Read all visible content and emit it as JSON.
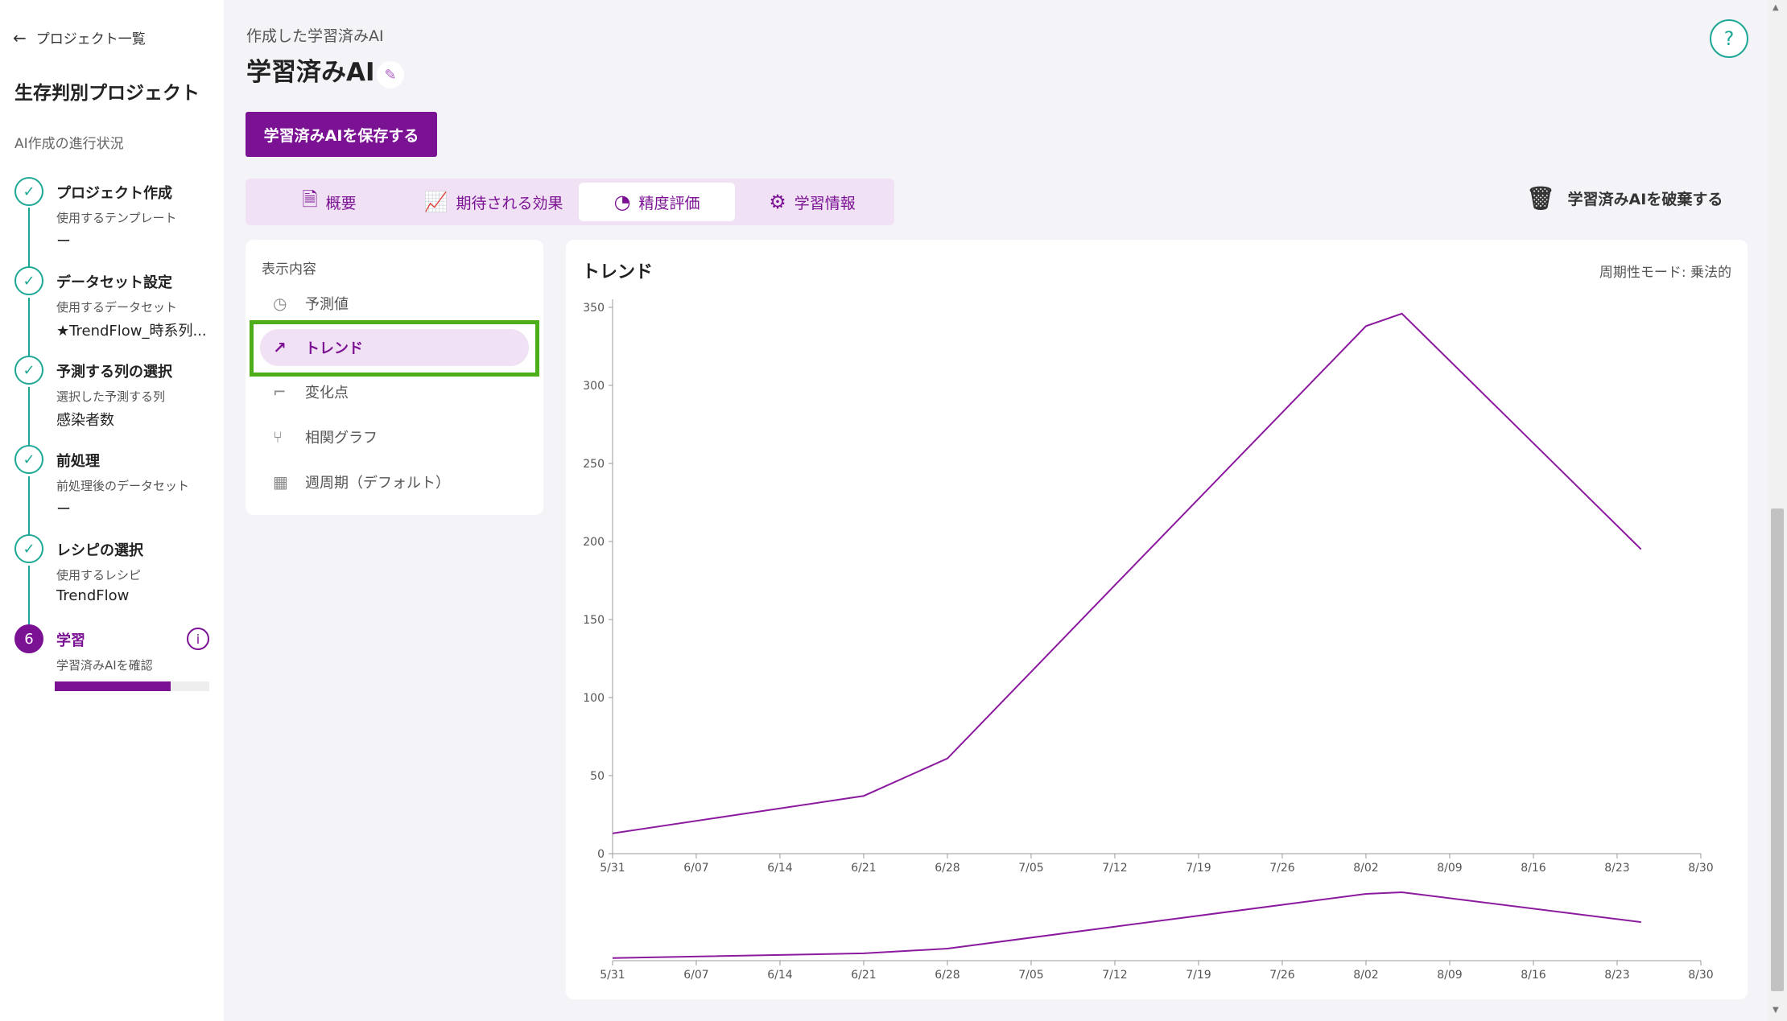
{
  "sidebar": {
    "back_label": "プロジェクト一覧",
    "project_title": "生存判別プロジェクト",
    "progress_heading": "AI作成の進行状況",
    "steps": [
      {
        "name": "プロジェクト作成",
        "sub": "使用するテンプレート",
        "value": "ー",
        "status": "done"
      },
      {
        "name": "データセット設定",
        "sub": "使用するデータセット",
        "value": "★TrendFlow_時系列...",
        "status": "done"
      },
      {
        "name": "予測する列の選択",
        "sub": "選択した予測する列",
        "value": "感染者数",
        "status": "done"
      },
      {
        "name": "前処理",
        "sub": "前処理後のデータセット",
        "value": "ー",
        "status": "done"
      },
      {
        "name": "レシピの選択",
        "sub": "使用するレシピ",
        "value": "TrendFlow",
        "status": "done"
      },
      {
        "name": "学習",
        "sub": "学習済みAIを確認",
        "number": "6",
        "status": "active",
        "progress": 0.75
      }
    ],
    "info_icon": "i"
  },
  "header": {
    "breadcrumb": "作成した学習済みAI",
    "title": "学習済みAI",
    "save_label": "学習済みAIを保存する",
    "help_icon": "?"
  },
  "tabs": [
    {
      "label": "概要",
      "icon": "document-icon"
    },
    {
      "label": "期待される効果",
      "icon": "line-chart-icon"
    },
    {
      "label": "精度評価",
      "icon": "gauge-icon",
      "active": true
    },
    {
      "label": "学習情報",
      "icon": "gear-icon"
    }
  ],
  "discard_label": "学習済みAIを破棄する",
  "display_menu": {
    "heading": "表示内容",
    "items": [
      {
        "label": "予測値",
        "icon": "forecast-icon"
      },
      {
        "label": "トレンド",
        "icon": "trend-icon",
        "active": true
      },
      {
        "label": "変化点",
        "icon": "changepoint-icon"
      },
      {
        "label": "相関グラフ",
        "icon": "correlation-icon"
      },
      {
        "label": "週周期（デフォルト）",
        "icon": "weekly-icon"
      }
    ]
  },
  "chart": {
    "title": "トレンド",
    "mode_label": "周期性モード: 乗法的"
  },
  "chart_data": {
    "type": "line",
    "x": [
      "5/31",
      "6/21",
      "6/28",
      "7/12",
      "8/02",
      "8/05",
      "8/25"
    ],
    "series": [
      {
        "values": [
          13,
          37,
          61,
          172,
          338,
          346,
          195
        ]
      }
    ],
    "x_ticks": [
      "5/31",
      "6/07",
      "6/14",
      "6/21",
      "6/28",
      "7/05",
      "7/12",
      "7/19",
      "7/26",
      "8/02",
      "8/09",
      "8/16",
      "8/23",
      "8/30"
    ],
    "y_ticks": [
      0,
      50,
      100,
      150,
      200,
      250,
      300,
      350
    ],
    "ylim": [
      0,
      350
    ],
    "color": "#8b1a9e",
    "overview_navigator": true
  }
}
